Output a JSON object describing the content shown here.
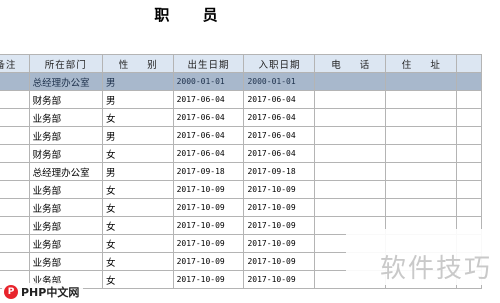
{
  "sheet": {
    "title": "职  员",
    "columns": [
      "备注",
      "所在部门",
      "性    别",
      "出生日期",
      "入职日期",
      "电    话",
      "住    址",
      ""
    ],
    "rows": [
      {
        "dept": "总经理办公室",
        "gender": "男",
        "birth": "2000-01-01",
        "hire": "2000-01-01",
        "selected": true
      },
      {
        "dept": "财务部",
        "gender": "男",
        "birth": "2017-06-04",
        "hire": "2017-06-04"
      },
      {
        "dept": "业务部",
        "gender": "女",
        "birth": "2017-06-04",
        "hire": "2017-06-04"
      },
      {
        "dept": "业务部",
        "gender": "男",
        "birth": "2017-06-04",
        "hire": "2017-06-04"
      },
      {
        "dept": "财务部",
        "gender": "女",
        "birth": "2017-06-04",
        "hire": "2017-06-04"
      },
      {
        "dept": "总经理办公室",
        "gender": "男",
        "birth": "2017-09-18",
        "hire": "2017-09-18"
      },
      {
        "dept": "业务部",
        "gender": "女",
        "birth": "2017-10-09",
        "hire": "2017-10-09"
      },
      {
        "dept": "业务部",
        "gender": "女",
        "birth": "2017-10-09",
        "hire": "2017-10-09"
      },
      {
        "dept": "业务部",
        "gender": "女",
        "birth": "2017-10-09",
        "hire": "2017-10-09"
      },
      {
        "dept": "业务部",
        "gender": "女",
        "birth": "2017-10-09",
        "hire": "2017-10-09"
      },
      {
        "dept": "业务部",
        "gender": "女",
        "birth": "2017-10-09",
        "hire": "2017-10-09"
      },
      {
        "dept": "业务部",
        "gender": "女",
        "birth": "2017-10-09",
        "hire": "2017-10-09"
      }
    ]
  },
  "overlay": {
    "watermark": "软件技巧",
    "logo_mark": "P",
    "logo_text": "PHP中文网"
  },
  "colors": {
    "header_bg": "#dce6f2",
    "selected_bg": "#a8b8cc",
    "grid_line": "#b4b4b4"
  }
}
